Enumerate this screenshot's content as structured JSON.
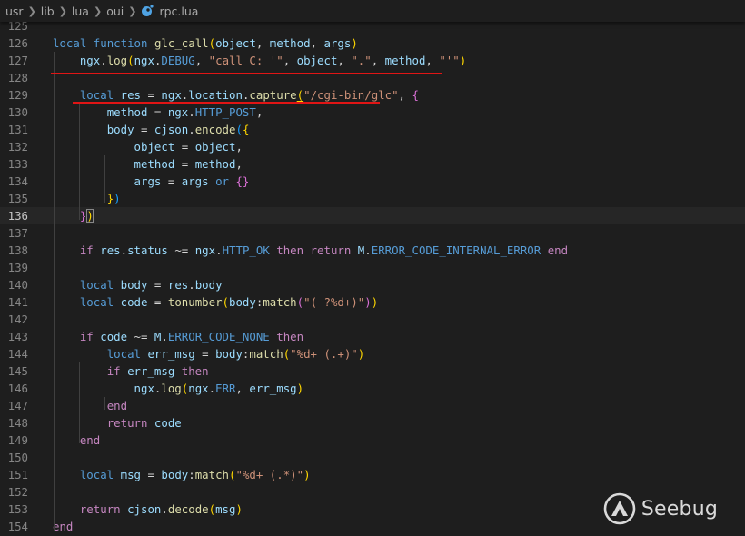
{
  "breadcrumb": {
    "items": [
      "usr",
      "lib",
      "lua",
      "oui"
    ],
    "separator": ">",
    "file": "rpc.lua",
    "file_icon": "lua-file-icon"
  },
  "editor": {
    "current_line": "136",
    "lines": [
      {
        "n": "125",
        "t": [
          [
            "",
            ""
          ]
        ]
      },
      {
        "n": "126",
        "t": [
          [
            "kb",
            "local"
          ],
          [
            "",
            " "
          ],
          [
            "kb",
            "function"
          ],
          [
            "",
            " "
          ],
          [
            "f",
            "glc_call"
          ],
          [
            "b1",
            "("
          ],
          [
            "v",
            "object"
          ],
          [
            "",
            ", "
          ],
          [
            "v",
            "method"
          ],
          [
            "",
            ", "
          ],
          [
            "v",
            "args"
          ],
          [
            "b1",
            ")"
          ]
        ]
      },
      {
        "n": "127",
        "t": [
          [
            "",
            "    "
          ],
          [
            "v",
            "ngx"
          ],
          [
            "",
            "."
          ],
          [
            "f",
            "log"
          ],
          [
            "b1",
            "("
          ],
          [
            "v",
            "ngx"
          ],
          [
            "",
            "."
          ],
          [
            "kb",
            "DEBUG"
          ],
          [
            "",
            ", "
          ],
          [
            "s",
            "\"call C: '\""
          ],
          [
            "",
            ", "
          ],
          [
            "v",
            "object"
          ],
          [
            "",
            ", "
          ],
          [
            "s",
            "\".\""
          ],
          [
            "",
            ", "
          ],
          [
            "v",
            "method"
          ],
          [
            "",
            ", "
          ],
          [
            "s",
            "\"'\""
          ],
          [
            "b1",
            ")"
          ]
        ]
      },
      {
        "n": "128",
        "t": [
          [
            "",
            ""
          ]
        ]
      },
      {
        "n": "129",
        "t": [
          [
            "",
            "    "
          ],
          [
            "kb",
            "local"
          ],
          [
            "",
            " "
          ],
          [
            "v",
            "res"
          ],
          [
            "",
            " = "
          ],
          [
            "v",
            "ngx"
          ],
          [
            "",
            "."
          ],
          [
            "v",
            "location"
          ],
          [
            "",
            "."
          ],
          [
            "f",
            "capture"
          ],
          [
            "b1 u",
            "("
          ],
          [
            "s",
            "\"/cgi-bin/glc\""
          ],
          [
            "",
            ", "
          ],
          [
            "b2",
            "{"
          ]
        ]
      },
      {
        "n": "130",
        "t": [
          [
            "",
            "        "
          ],
          [
            "v",
            "method"
          ],
          [
            "",
            " = "
          ],
          [
            "v",
            "ngx"
          ],
          [
            "",
            "."
          ],
          [
            "kb",
            "HTTP_POST"
          ],
          [
            "",
            ","
          ]
        ]
      },
      {
        "n": "131",
        "t": [
          [
            "",
            "        "
          ],
          [
            "v",
            "body"
          ],
          [
            "",
            " = "
          ],
          [
            "v",
            "cjson"
          ],
          [
            "",
            "."
          ],
          [
            "f",
            "encode"
          ],
          [
            "b3",
            "("
          ],
          [
            "b1",
            "{"
          ]
        ]
      },
      {
        "n": "132",
        "t": [
          [
            "",
            "            "
          ],
          [
            "v",
            "object"
          ],
          [
            "",
            " = "
          ],
          [
            "v",
            "object"
          ],
          [
            "",
            ","
          ]
        ]
      },
      {
        "n": "133",
        "t": [
          [
            "",
            "            "
          ],
          [
            "v",
            "method"
          ],
          [
            "",
            " = "
          ],
          [
            "v",
            "method"
          ],
          [
            "",
            ","
          ]
        ]
      },
      {
        "n": "134",
        "t": [
          [
            "",
            "            "
          ],
          [
            "v",
            "args"
          ],
          [
            "",
            " = "
          ],
          [
            "v",
            "args"
          ],
          [
            "",
            " "
          ],
          [
            "kb",
            "or"
          ],
          [
            "",
            " "
          ],
          [
            "b2",
            "{}"
          ]
        ]
      },
      {
        "n": "135",
        "t": [
          [
            "",
            "        "
          ],
          [
            "b1",
            "}"
          ],
          [
            "b3",
            ")"
          ]
        ]
      },
      {
        "n": "136",
        "t": [
          [
            "",
            "    "
          ],
          [
            "b2",
            "}"
          ],
          [
            "b1 bm",
            ")"
          ]
        ]
      },
      {
        "n": "137",
        "t": [
          [
            "",
            ""
          ]
        ]
      },
      {
        "n": "138",
        "t": [
          [
            "",
            "    "
          ],
          [
            "k",
            "if"
          ],
          [
            "",
            " "
          ],
          [
            "v",
            "res"
          ],
          [
            "",
            "."
          ],
          [
            "v",
            "status"
          ],
          [
            "",
            " ~= "
          ],
          [
            "v",
            "ngx"
          ],
          [
            "",
            "."
          ],
          [
            "kb",
            "HTTP_OK"
          ],
          [
            "",
            " "
          ],
          [
            "k",
            "then"
          ],
          [
            "",
            " "
          ],
          [
            "k",
            "return"
          ],
          [
            "",
            " "
          ],
          [
            "v",
            "M"
          ],
          [
            "",
            "."
          ],
          [
            "kb",
            "ERROR_CODE_INTERNAL_ERROR"
          ],
          [
            "",
            " "
          ],
          [
            "k",
            "end"
          ]
        ]
      },
      {
        "n": "139",
        "t": [
          [
            "",
            ""
          ]
        ]
      },
      {
        "n": "140",
        "t": [
          [
            "",
            "    "
          ],
          [
            "kb",
            "local"
          ],
          [
            "",
            " "
          ],
          [
            "v",
            "body"
          ],
          [
            "",
            " = "
          ],
          [
            "v",
            "res"
          ],
          [
            "",
            "."
          ],
          [
            "v",
            "body"
          ]
        ]
      },
      {
        "n": "141",
        "t": [
          [
            "",
            "    "
          ],
          [
            "kb",
            "local"
          ],
          [
            "",
            " "
          ],
          [
            "v",
            "code"
          ],
          [
            "",
            " = "
          ],
          [
            "f",
            "tonumber"
          ],
          [
            "b1",
            "("
          ],
          [
            "v",
            "body"
          ],
          [
            "",
            ":"
          ],
          [
            "f",
            "match"
          ],
          [
            "b2",
            "("
          ],
          [
            "s",
            "\"(-?%d+)\""
          ],
          [
            "b2",
            ")"
          ],
          [
            "b1",
            ")"
          ]
        ]
      },
      {
        "n": "142",
        "t": [
          [
            "",
            ""
          ]
        ]
      },
      {
        "n": "143",
        "t": [
          [
            "",
            "    "
          ],
          [
            "k",
            "if"
          ],
          [
            "",
            " "
          ],
          [
            "v",
            "code"
          ],
          [
            "",
            " ~= "
          ],
          [
            "v",
            "M"
          ],
          [
            "",
            "."
          ],
          [
            "kb",
            "ERROR_CODE_NONE"
          ],
          [
            "",
            " "
          ],
          [
            "k",
            "then"
          ]
        ]
      },
      {
        "n": "144",
        "t": [
          [
            "",
            "        "
          ],
          [
            "kb",
            "local"
          ],
          [
            "",
            " "
          ],
          [
            "v",
            "err_msg"
          ],
          [
            "",
            " = "
          ],
          [
            "v",
            "body"
          ],
          [
            "",
            ":"
          ],
          [
            "f",
            "match"
          ],
          [
            "b1",
            "("
          ],
          [
            "s",
            "\"%d+ (.+)\""
          ],
          [
            "b1",
            ")"
          ]
        ]
      },
      {
        "n": "145",
        "t": [
          [
            "",
            "        "
          ],
          [
            "k",
            "if"
          ],
          [
            "",
            " "
          ],
          [
            "v",
            "err_msg"
          ],
          [
            "",
            " "
          ],
          [
            "k",
            "then"
          ]
        ]
      },
      {
        "n": "146",
        "t": [
          [
            "",
            "            "
          ],
          [
            "v",
            "ngx"
          ],
          [
            "",
            "."
          ],
          [
            "f",
            "log"
          ],
          [
            "b1",
            "("
          ],
          [
            "v",
            "ngx"
          ],
          [
            "",
            "."
          ],
          [
            "kb",
            "ERR"
          ],
          [
            "",
            ", "
          ],
          [
            "v",
            "err_msg"
          ],
          [
            "b1",
            ")"
          ]
        ]
      },
      {
        "n": "147",
        "t": [
          [
            "",
            "        "
          ],
          [
            "k",
            "end"
          ]
        ]
      },
      {
        "n": "148",
        "t": [
          [
            "",
            "        "
          ],
          [
            "k",
            "return"
          ],
          [
            "",
            " "
          ],
          [
            "v",
            "code"
          ]
        ]
      },
      {
        "n": "149",
        "t": [
          [
            "",
            "    "
          ],
          [
            "k",
            "end"
          ]
        ]
      },
      {
        "n": "150",
        "t": [
          [
            "",
            ""
          ]
        ]
      },
      {
        "n": "151",
        "t": [
          [
            "",
            "    "
          ],
          [
            "kb",
            "local"
          ],
          [
            "",
            " "
          ],
          [
            "v",
            "msg"
          ],
          [
            "",
            " = "
          ],
          [
            "v",
            "body"
          ],
          [
            "",
            ":"
          ],
          [
            "f",
            "match"
          ],
          [
            "b1",
            "("
          ],
          [
            "s",
            "\"%d+ (.*)\""
          ],
          [
            "b1",
            ")"
          ]
        ]
      },
      {
        "n": "152",
        "t": [
          [
            "",
            ""
          ]
        ]
      },
      {
        "n": "153",
        "t": [
          [
            "",
            "    "
          ],
          [
            "k",
            "return"
          ],
          [
            "",
            " "
          ],
          [
            "v",
            "cjson"
          ],
          [
            "",
            "."
          ],
          [
            "f",
            "decode"
          ],
          [
            "b1",
            "("
          ],
          [
            "v",
            "msg"
          ],
          [
            "b1",
            ")"
          ]
        ]
      },
      {
        "n": "154",
        "t": [
          [
            "k",
            "end"
          ]
        ]
      }
    ]
  },
  "watermark": {
    "text": "Seebug",
    "icon": "seebug-logo-icon"
  }
}
